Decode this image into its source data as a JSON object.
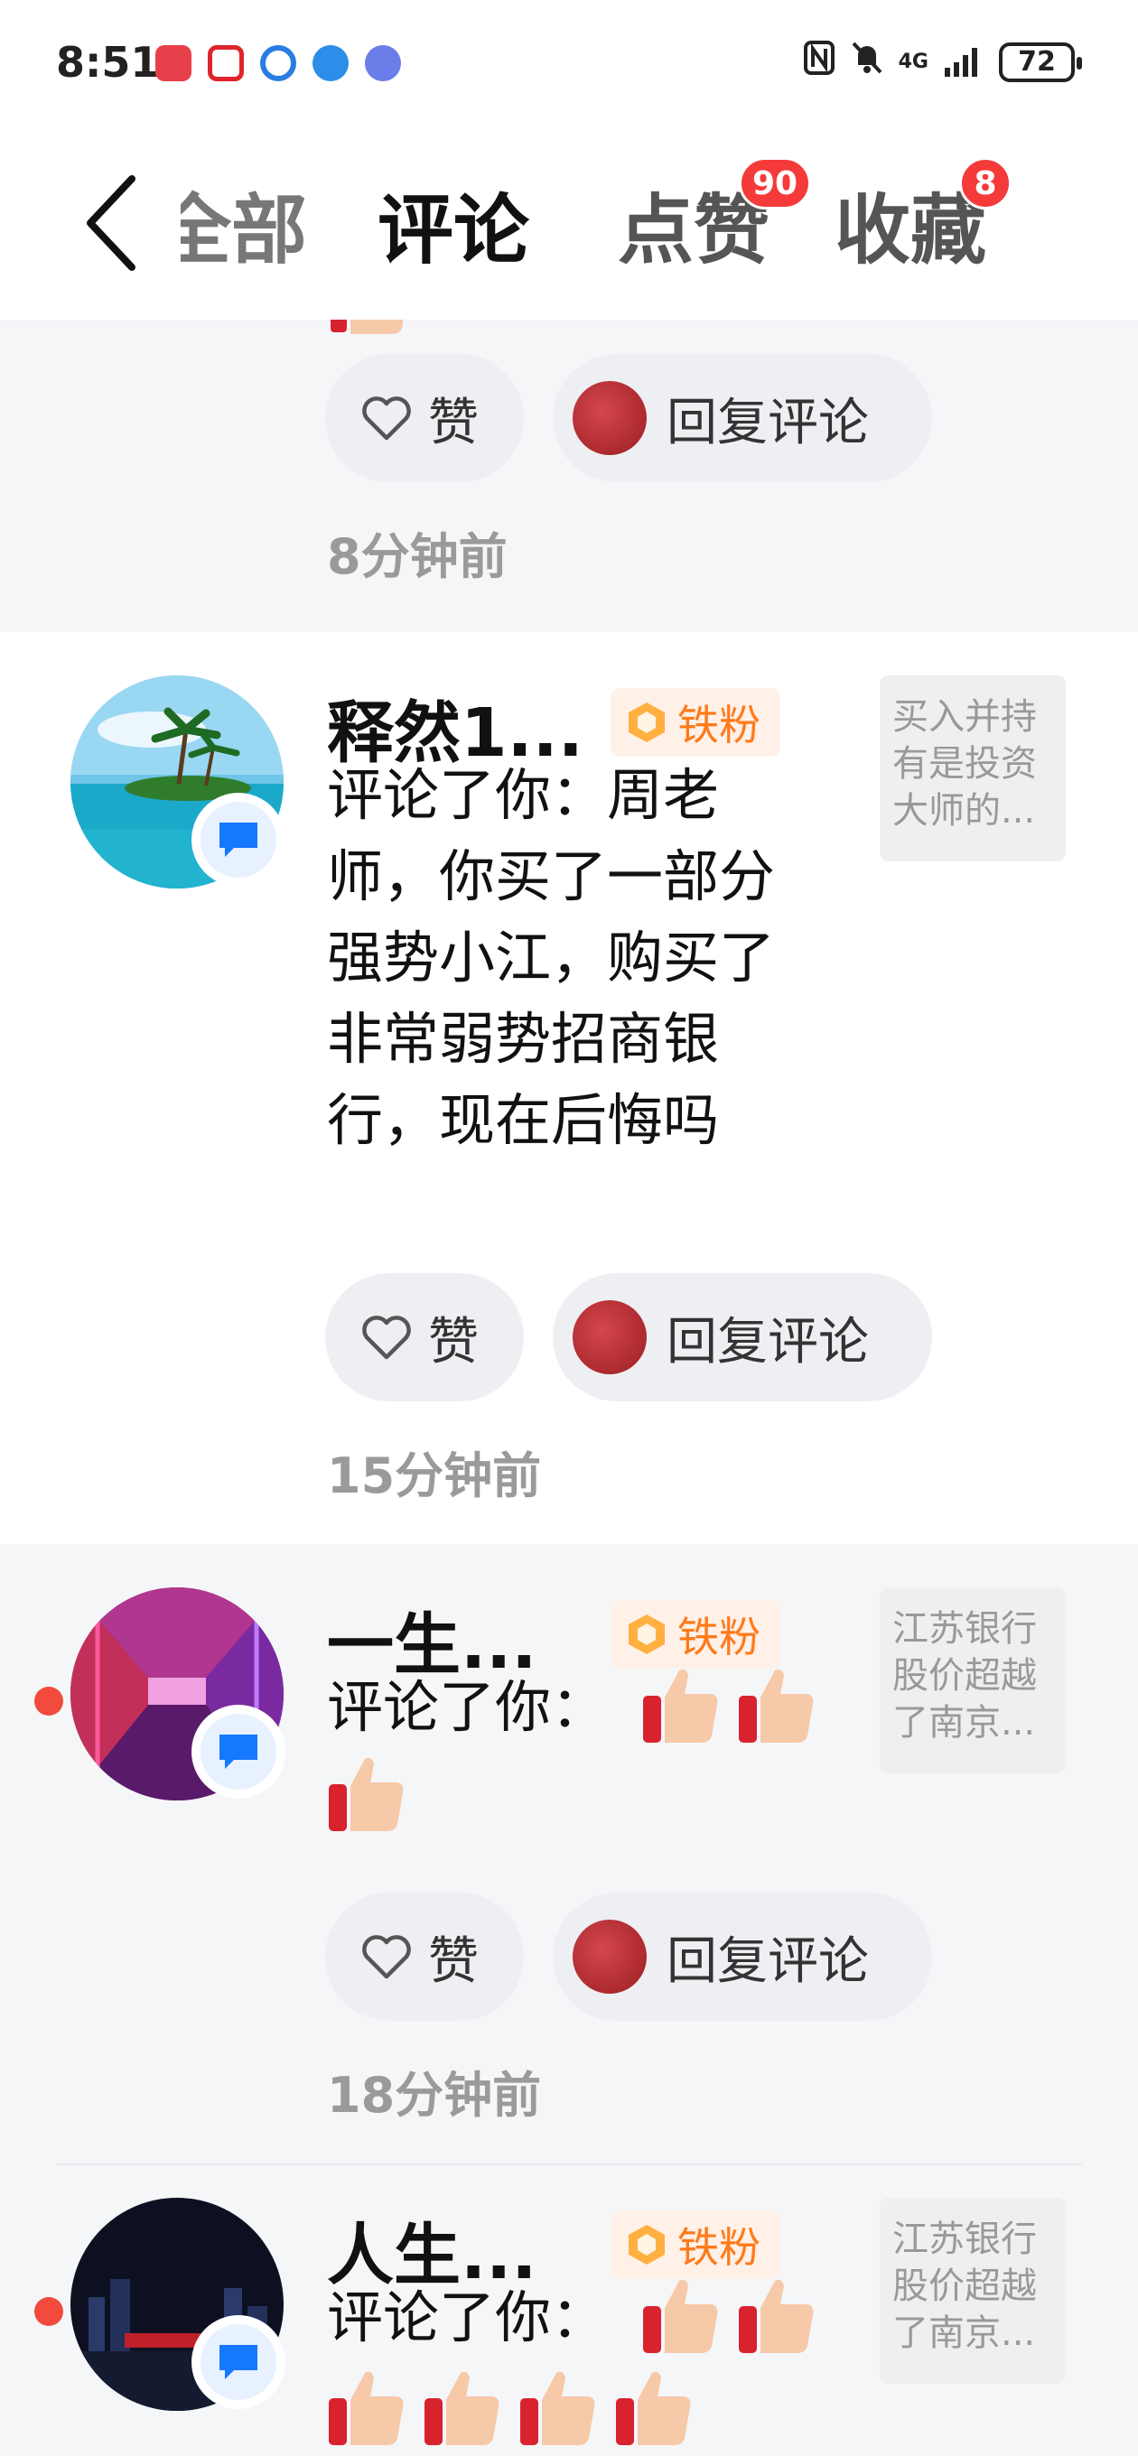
{
  "status_bar": {
    "time": "8:51",
    "network": "4G",
    "battery": "72"
  },
  "header": {
    "tabs": [
      {
        "label": "全部"
      },
      {
        "label": "评论"
      },
      {
        "label": "点赞",
        "badge": "90"
      },
      {
        "label": "收藏",
        "badge": "8"
      }
    ],
    "active_tab": "评论"
  },
  "top_partial_item": {
    "like_label": "赞",
    "reply_label": "回复评论",
    "time": "8分钟前"
  },
  "items": [
    {
      "name": "释然1...",
      "fan_label": "铁粉",
      "text": "评论了你：周老师，你买了一部分强势小江，购买了非常弱势招商银行，现在后悔吗",
      "thumb_text": "买入并持有是投资大师的...",
      "like_label": "赞",
      "reply_label": "回复评论",
      "time": "15分钟前",
      "unread": false
    },
    {
      "name": "一生...",
      "fan_label": "铁粉",
      "text": "评论了你：",
      "thumb_text": "江苏银行股价超越了南京...",
      "like_label": "赞",
      "reply_label": "回复评论",
      "time": "18分钟前",
      "unread": true
    },
    {
      "name": "人生...",
      "fan_label": "铁粉",
      "text": "评论了你：",
      "thumb_text": "江苏银行股价超越了南京...",
      "unread": true
    }
  ],
  "colors": {
    "accent_red": "#f53a3a",
    "fan_orange": "#ff7a1a",
    "feed_bg": "#f5f6f8"
  }
}
